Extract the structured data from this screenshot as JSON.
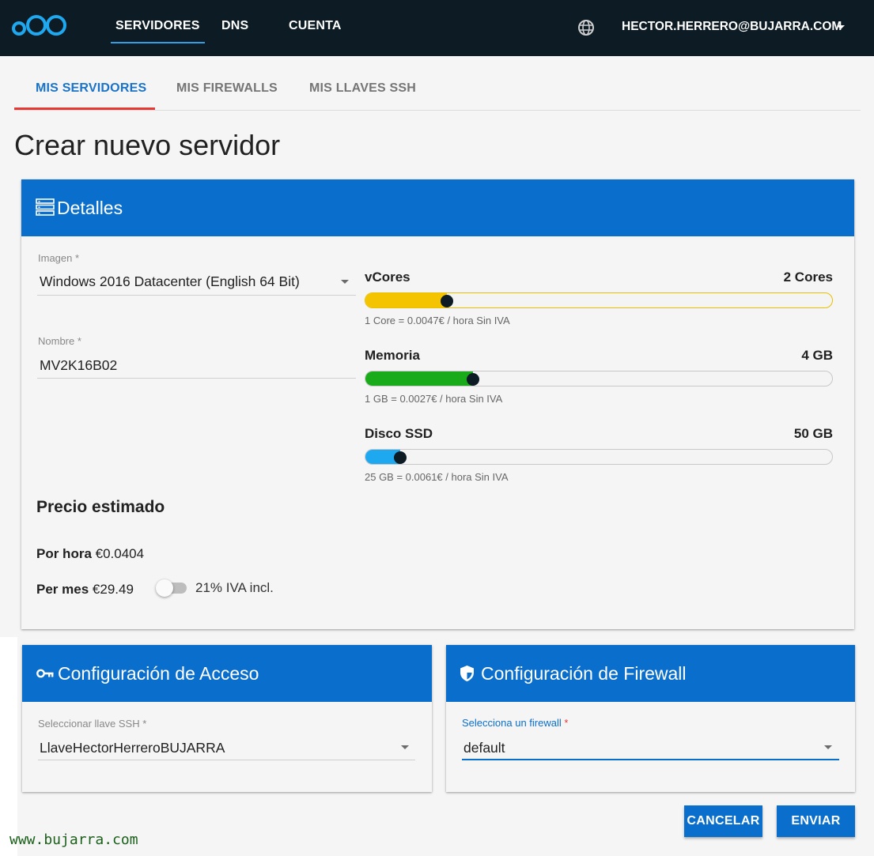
{
  "topbar": {
    "nav": [
      "SERVIDORES",
      "DNS",
      "CUENTA"
    ],
    "user": "HECTOR.HERRERO@BUJARRA.COM"
  },
  "tabs": [
    "MIS SERVIDORES",
    "MIS FIREWALLS",
    "MIS LLAVES SSH"
  ],
  "page_title": "Crear nuevo servidor",
  "details": {
    "header": "Detalles",
    "image_label": "Imagen",
    "image_value": "Windows 2016 Datacenter (English 64 Bit)",
    "name_label": "Nombre",
    "name_value": "MV2K16B02",
    "required_mark": "*",
    "sliders": [
      {
        "title": "vCores",
        "amount": "2 Cores",
        "note": "1 Core = 0.0047€ / hora Sin IVA",
        "level": 0.175,
        "color": "#f5c400"
      },
      {
        "title": "Memoria",
        "amount": "4 GB",
        "note": "1 GB = 0.0027€ / hora Sin IVA",
        "level": 0.23,
        "color": "#1aab1a"
      },
      {
        "title": "Disco SSD",
        "amount": "50 GB",
        "note": "25 GB = 0.0061€ / hora Sin IVA",
        "level": 0.075,
        "color": "#1ea8f0"
      }
    ],
    "price_title": "Precio estimado",
    "per_hour_label": "Por hora",
    "per_hour_value": "€0.0404",
    "per_month_label": "Per mes",
    "per_month_value": "€29.49",
    "vat_toggle_label": "21% IVA incl.",
    "vat_toggle_on": false
  },
  "access": {
    "header": "Configuración de Acceso",
    "label": "Seleccionar llave SSH",
    "value": "LlaveHectorHerreroBUJARRA"
  },
  "firewall": {
    "header": "Configuración de Firewall",
    "label": "Selecciona un firewall",
    "value": "default"
  },
  "buttons": {
    "cancel": "CANCELAR",
    "submit": "ENVIAR"
  },
  "watermark": "www.bujarra.com",
  "colors": {
    "accent": "#0a6fcc",
    "topbar": "#0d1b24",
    "tab_indicator": "#e53935"
  }
}
